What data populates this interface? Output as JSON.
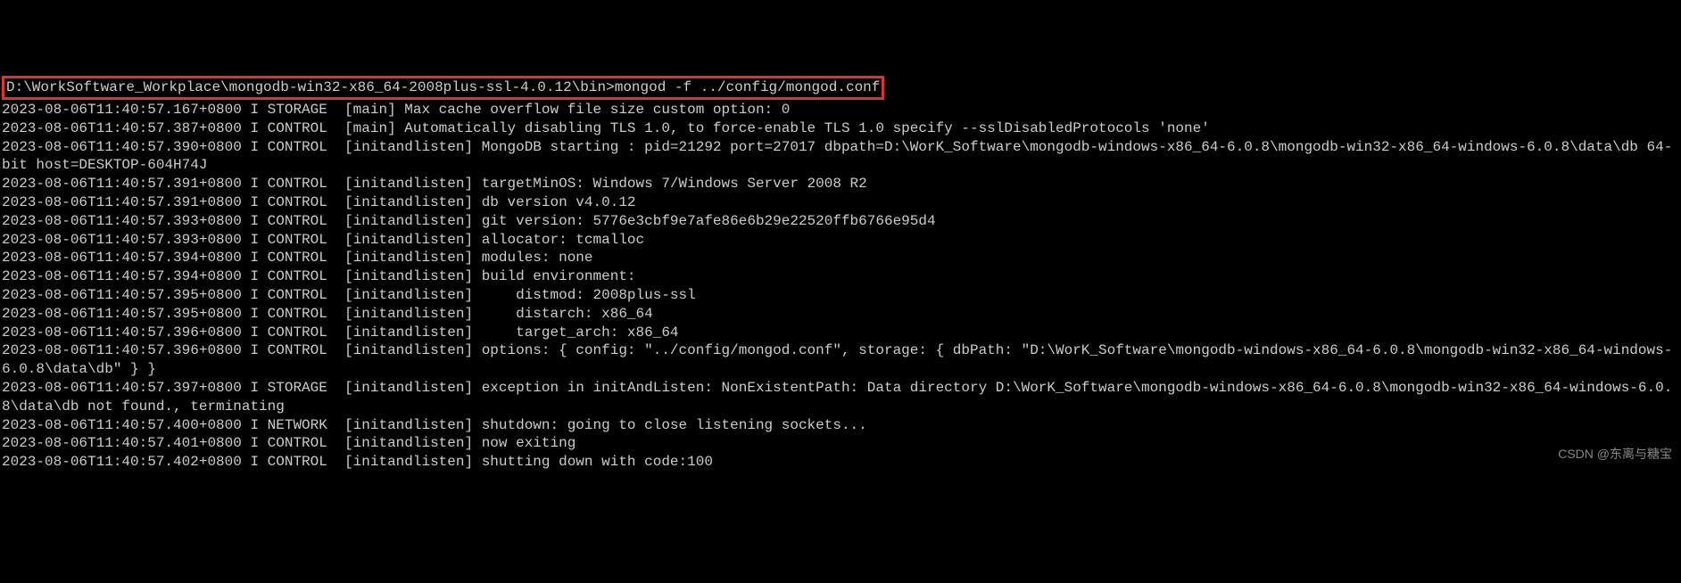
{
  "command_line": {
    "prompt": "D:\\WorkSoftware_Workplace\\mongodb-win32-x86_64-2008plus-ssl-4.0.12\\bin>",
    "command": "mongod -f ../config/mongod.conf"
  },
  "log_lines": [
    "2023-08-06T11:40:57.167+0800 I STORAGE  [main] Max cache overflow file size custom option: 0",
    "2023-08-06T11:40:57.387+0800 I CONTROL  [main] Automatically disabling TLS 1.0, to force-enable TLS 1.0 specify --sslDisabledProtocols 'none'",
    "2023-08-06T11:40:57.390+0800 I CONTROL  [initandlisten] MongoDB starting : pid=21292 port=27017 dbpath=D:\\WorK_Software\\mongodb-windows-x86_64-6.0.8\\mongodb-win32-x86_64-windows-6.0.8\\data\\db 64-bit host=DESKTOP-604H74J",
    "2023-08-06T11:40:57.391+0800 I CONTROL  [initandlisten] targetMinOS: Windows 7/Windows Server 2008 R2",
    "2023-08-06T11:40:57.391+0800 I CONTROL  [initandlisten] db version v4.0.12",
    "2023-08-06T11:40:57.393+0800 I CONTROL  [initandlisten] git version: 5776e3cbf9e7afe86e6b29e22520ffb6766e95d4",
    "2023-08-06T11:40:57.393+0800 I CONTROL  [initandlisten] allocator: tcmalloc",
    "2023-08-06T11:40:57.394+0800 I CONTROL  [initandlisten] modules: none",
    "2023-08-06T11:40:57.394+0800 I CONTROL  [initandlisten] build environment:",
    "2023-08-06T11:40:57.395+0800 I CONTROL  [initandlisten]     distmod: 2008plus-ssl",
    "2023-08-06T11:40:57.395+0800 I CONTROL  [initandlisten]     distarch: x86_64",
    "2023-08-06T11:40:57.396+0800 I CONTROL  [initandlisten]     target_arch: x86_64",
    "2023-08-06T11:40:57.396+0800 I CONTROL  [initandlisten] options: { config: \"../config/mongod.conf\", storage: { dbPath: \"D:\\WorK_Software\\mongodb-windows-x86_64-6.0.8\\mongodb-win32-x86_64-windows-6.0.8\\data\\db\" } }",
    "2023-08-06T11:40:57.397+0800 I STORAGE  [initandlisten] exception in initAndListen: NonExistentPath: Data directory D:\\WorK_Software\\mongodb-windows-x86_64-6.0.8\\mongodb-win32-x86_64-windows-6.0.8\\data\\db not found., terminating",
    "2023-08-06T11:40:57.400+0800 I NETWORK  [initandlisten] shutdown: going to close listening sockets...",
    "2023-08-06T11:40:57.401+0800 I CONTROL  [initandlisten] now exiting",
    "2023-08-06T11:40:57.402+0800 I CONTROL  [initandlisten] shutting down with code:100"
  ],
  "watermark": "CSDN @东离与糖宝"
}
